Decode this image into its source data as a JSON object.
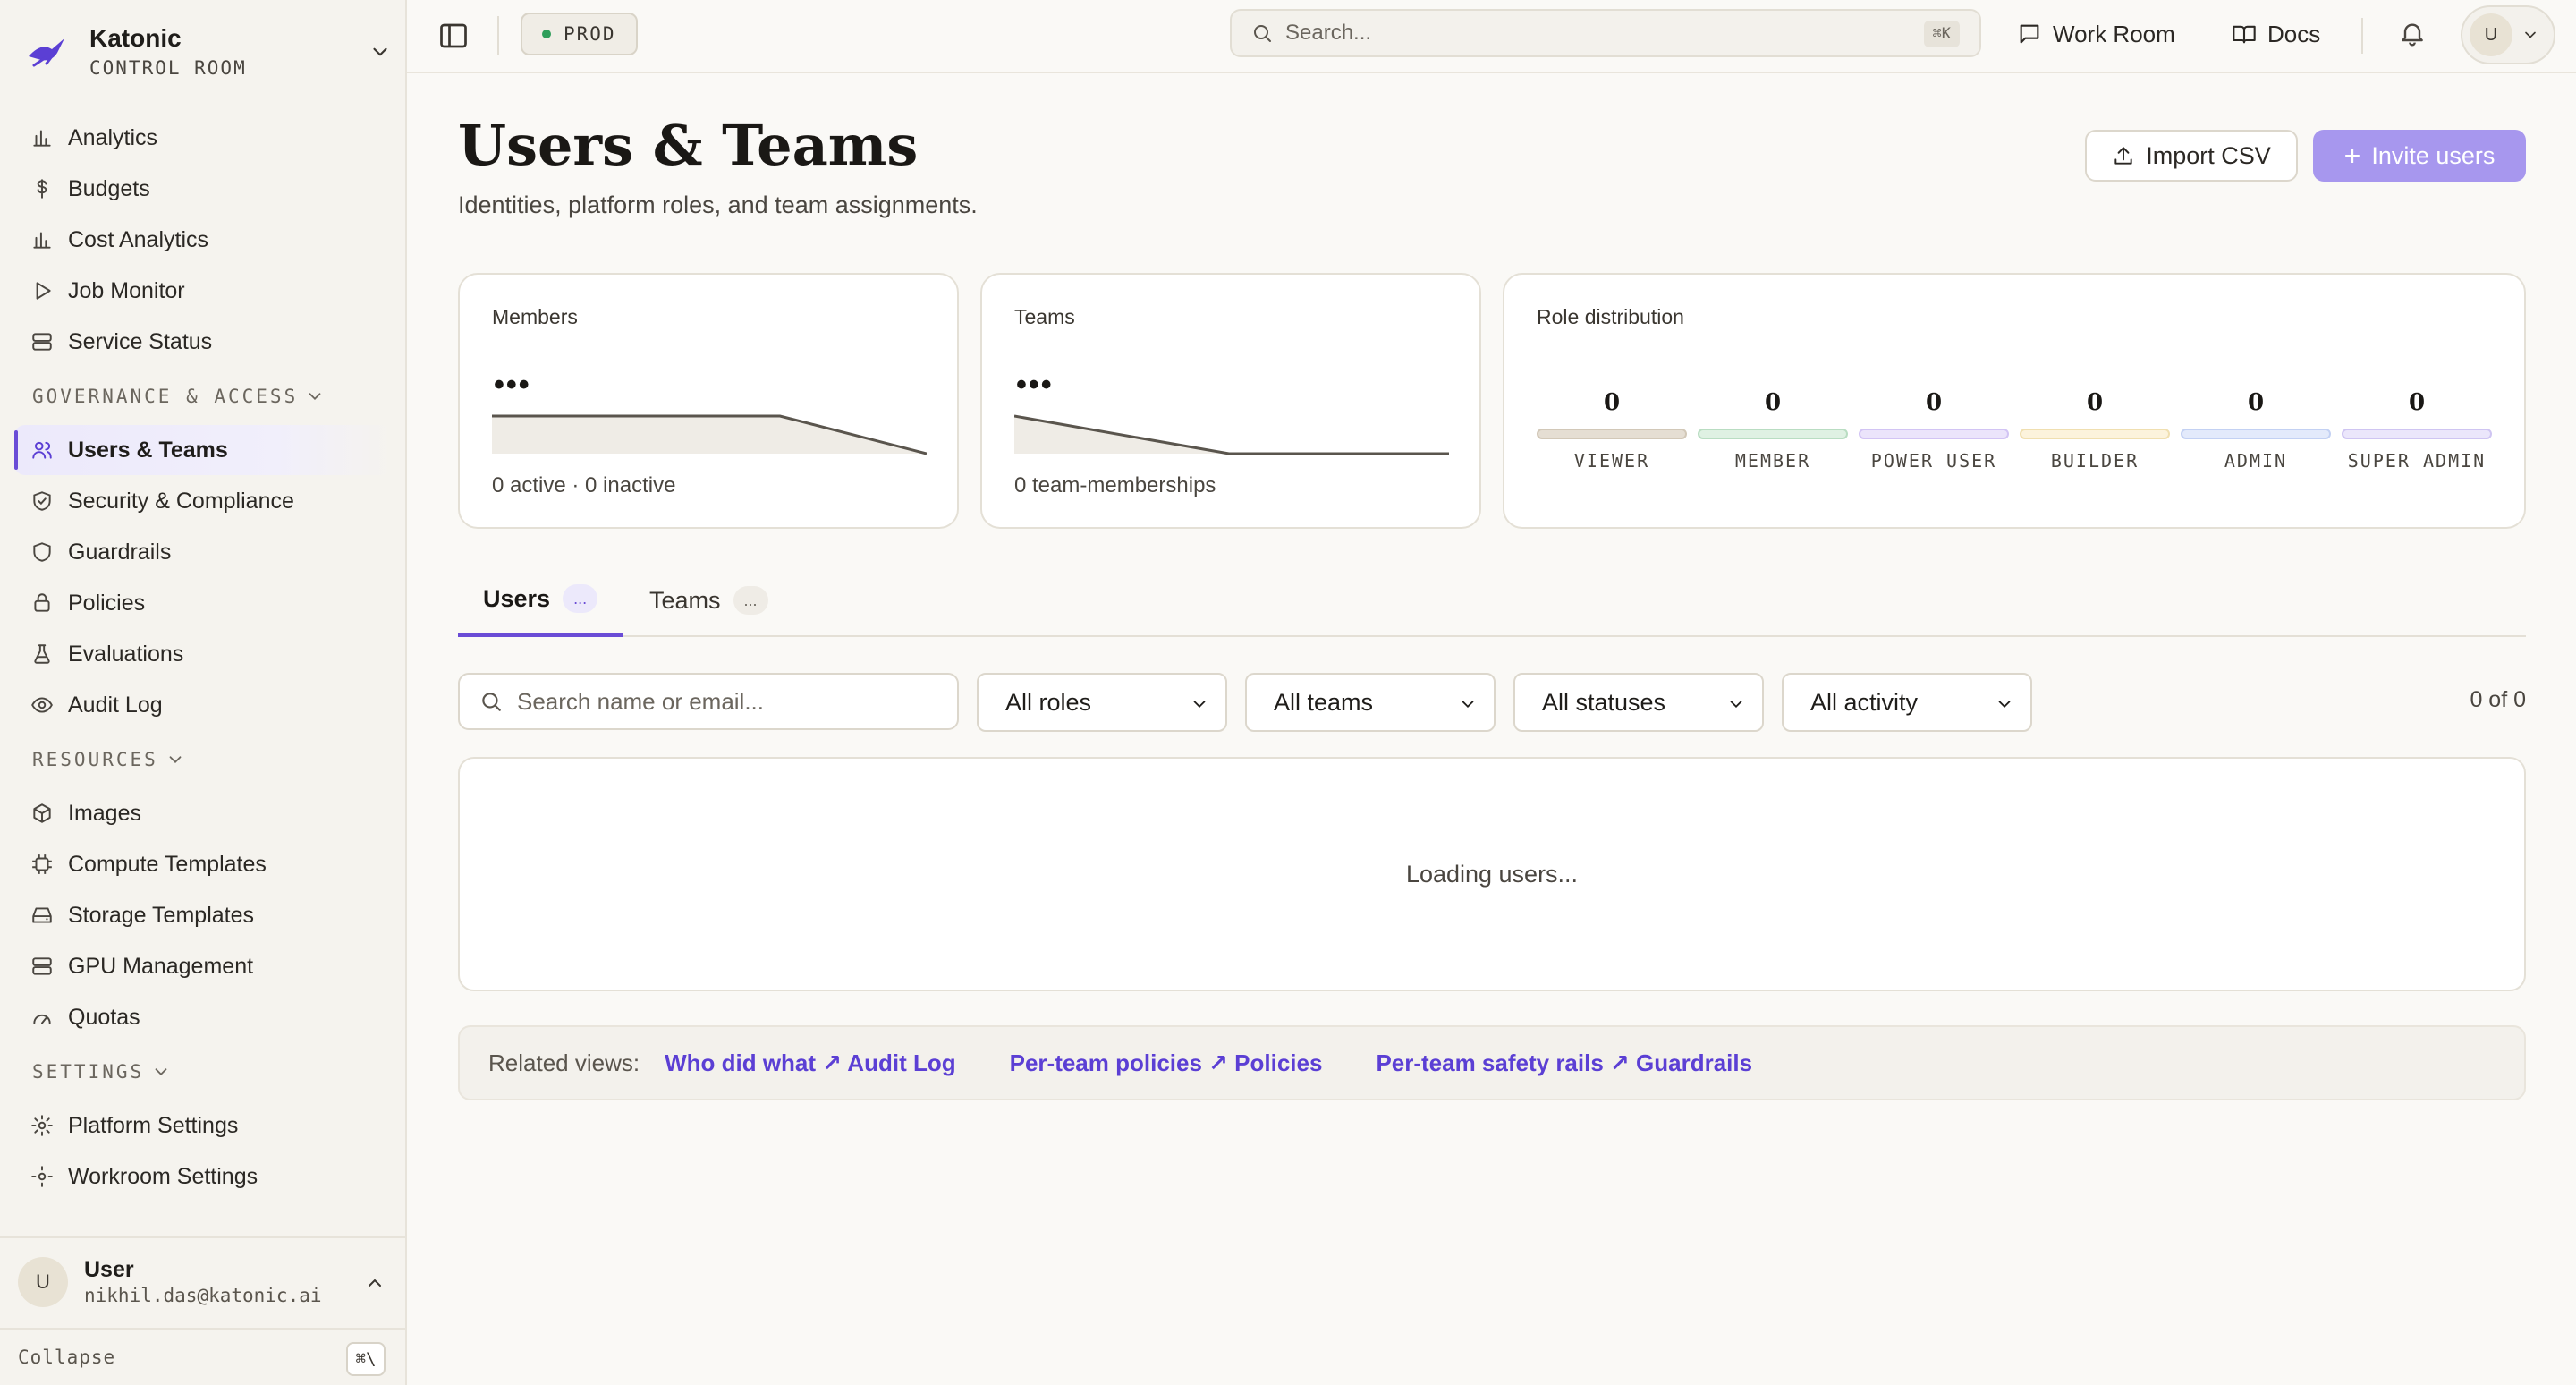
{
  "brand": {
    "name": "Katonic",
    "subtitle": "CONTROL ROOM"
  },
  "sidebar": {
    "top_items": [
      {
        "label": "Analytics",
        "icon": "bar-chart-icon"
      },
      {
        "label": "Budgets",
        "icon": "dollar-icon"
      },
      {
        "label": "Cost Analytics",
        "icon": "bar-chart-icon"
      },
      {
        "label": "Job Monitor",
        "icon": "play-icon"
      },
      {
        "label": "Service Status",
        "icon": "server-icon"
      }
    ],
    "governance": {
      "title": "GOVERNANCE & ACCESS",
      "items": [
        {
          "label": "Users & Teams",
          "icon": "users-icon",
          "active": true
        },
        {
          "label": "Security & Compliance",
          "icon": "shield-icon"
        },
        {
          "label": "Guardrails",
          "icon": "shield-icon"
        },
        {
          "label": "Policies",
          "icon": "lock-icon"
        },
        {
          "label": "Evaluations",
          "icon": "flask-icon"
        },
        {
          "label": "Audit Log",
          "icon": "eye-icon"
        }
      ]
    },
    "resources": {
      "title": "RESOURCES",
      "items": [
        {
          "label": "Images",
          "icon": "package-icon"
        },
        {
          "label": "Compute Templates",
          "icon": "cpu-icon"
        },
        {
          "label": "Storage Templates",
          "icon": "hard-drive-icon"
        },
        {
          "label": "GPU Management",
          "icon": "server-icon"
        },
        {
          "label": "Quotas",
          "icon": "gauge-icon"
        }
      ]
    },
    "settings": {
      "title": "SETTINGS",
      "items": [
        {
          "label": "Platform Settings",
          "icon": "gear-icon"
        },
        {
          "label": "Workroom Settings",
          "icon": "gear-icon"
        }
      ]
    },
    "user": {
      "initial": "U",
      "name": "User",
      "email": "nikhil.das@katonic.ai"
    },
    "collapse": {
      "label": "Collapse",
      "shortcut": "⌘\\"
    }
  },
  "topbar": {
    "env": "PROD",
    "search_placeholder": "Search...",
    "search_shortcut": "⌘K",
    "work_room": "Work Room",
    "docs": "Docs",
    "user_initial": "U"
  },
  "page": {
    "title": "Users & Teams",
    "subtitle": "Identities, platform roles, and team assignments.",
    "import_label": "Import CSV",
    "invite_label": "Invite users"
  },
  "cards": {
    "members": {
      "label": "Members",
      "value": "•••",
      "footer": "0 active · 0 inactive"
    },
    "teams": {
      "label": "Teams",
      "value": "•••",
      "footer": "0 team-memberships"
    },
    "roles": {
      "label": "Role distribution",
      "items": [
        {
          "name": "VIEWER",
          "count": "0",
          "color": "#e5ded3",
          "border": "#d2c8b8"
        },
        {
          "name": "MEMBER",
          "count": "0",
          "color": "#dff1e3",
          "border": "#b9ddc2"
        },
        {
          "name": "POWER USER",
          "count": "0",
          "color": "#ebe4fb",
          "border": "#d2c4f4"
        },
        {
          "name": "BUILDER",
          "count": "0",
          "color": "#fcf3dc",
          "border": "#f0dfb0"
        },
        {
          "name": "ADMIN",
          "count": "0",
          "color": "#e3eafb",
          "border": "#c3d1f3"
        },
        {
          "name": "SUPER ADMIN",
          "count": "0",
          "color": "#ebe6fb",
          "border": "#cfc5f2"
        }
      ]
    }
  },
  "tabs": [
    {
      "label": "Users",
      "count": "..."
    },
    {
      "label": "Teams",
      "count": "..."
    }
  ],
  "filters": {
    "search_placeholder": "Search name or email...",
    "roles": "All roles",
    "teams": "All teams",
    "statuses": "All statuses",
    "activity": "All activity",
    "count": "0 of 0"
  },
  "table": {
    "loading": "Loading users..."
  },
  "related": {
    "label": "Related views:",
    "links": [
      "Who did what ↗ Audit Log",
      "Per-team policies ↗ Policies",
      "Per-team safety rails ↗ Guardrails"
    ]
  },
  "colors": {
    "accent": "#6a4cd6",
    "invite_bg": "#a797ee",
    "link": "#5b3fd4"
  }
}
